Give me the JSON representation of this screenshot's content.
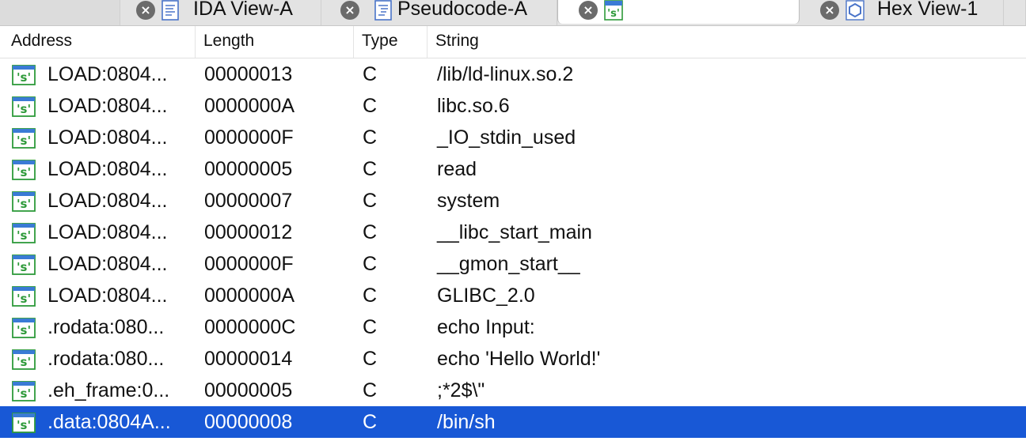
{
  "tabs": [
    {
      "label": "IDA View-A",
      "icon": "disassembly-view-icon"
    },
    {
      "label": "Pseudocode-A",
      "icon": "pseudocode-view-icon"
    },
    {
      "label": "",
      "icon": "strings-view-icon"
    },
    {
      "label": "Hex View-1",
      "icon": "hex-view-icon"
    }
  ],
  "table": {
    "columns": {
      "address": "Address",
      "length": "Length",
      "type": "Type",
      "string": "String"
    },
    "rows": [
      {
        "address": "LOAD:0804...",
        "length": "00000013",
        "type": "C",
        "string": "/lib/ld-linux.so.2"
      },
      {
        "address": "LOAD:0804...",
        "length": "0000000A",
        "type": "C",
        "string": "libc.so.6"
      },
      {
        "address": "LOAD:0804...",
        "length": "0000000F",
        "type": "C",
        "string": "_IO_stdin_used"
      },
      {
        "address": "LOAD:0804...",
        "length": "00000005",
        "type": "C",
        "string": "read"
      },
      {
        "address": "LOAD:0804...",
        "length": "00000007",
        "type": "C",
        "string": "system"
      },
      {
        "address": "LOAD:0804...",
        "length": "00000012",
        "type": "C",
        "string": "__libc_start_main"
      },
      {
        "address": "LOAD:0804...",
        "length": "0000000F",
        "type": "C",
        "string": "__gmon_start__"
      },
      {
        "address": "LOAD:0804...",
        "length": "0000000A",
        "type": "C",
        "string": "GLIBC_2.0"
      },
      {
        "address": ".rodata:080...",
        "length": "0000000C",
        "type": "C",
        "string": "echo Input:"
      },
      {
        "address": ".rodata:080...",
        "length": "00000014",
        "type": "C",
        "string": "echo 'Hello World!'"
      },
      {
        "address": ".eh_frame:0...",
        "length": "00000005",
        "type": "C",
        "string": ";*2$\\\""
      },
      {
        "address": ".data:0804A...",
        "length": "00000008",
        "type": "C",
        "string": "/bin/sh"
      }
    ],
    "selected_row": 11,
    "row_icon": "string-item-icon"
  },
  "colors": {
    "selection": "#1858d6",
    "icon_green": "#2e9a3a",
    "icon_blue": "#3a7bd5"
  }
}
